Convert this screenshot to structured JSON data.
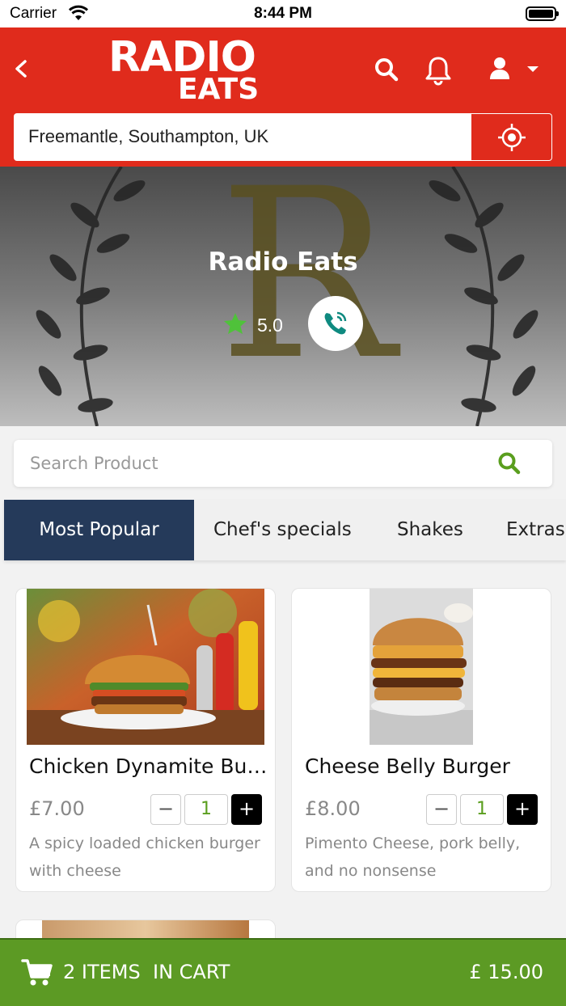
{
  "status_bar": {
    "carrier": "Carrier",
    "time": "8:44 PM"
  },
  "header": {
    "logo_top": "RADIO",
    "logo_bottom": "EATS",
    "location": "Freemantle, Southampton, UK",
    "icons": [
      "back-icon",
      "search-icon",
      "bell-icon",
      "user-icon",
      "chevron-down-icon",
      "locate-icon"
    ]
  },
  "hero": {
    "restaurant_name": "Radio Eats",
    "rating": "5.0",
    "logo_letter": "R"
  },
  "search": {
    "placeholder": "Search Product"
  },
  "tabs": [
    {
      "label": "Most Popular",
      "active": true
    },
    {
      "label": "Chef's specials",
      "active": false
    },
    {
      "label": "Shakes",
      "active": false
    },
    {
      "label": "Extras",
      "active": false
    }
  ],
  "products": [
    {
      "name": "Chicken Dynamite Burger",
      "price": "£7.00",
      "quantity": "1",
      "description": "A spicy loaded chicken burger with cheese"
    },
    {
      "name": "Cheese Belly Burger",
      "price": "£8.00",
      "quantity": "1",
      "description": "Pimento Cheese, pork belly, and no nonsense"
    }
  ],
  "quantity_controls": {
    "minus": "−",
    "plus": "+"
  },
  "cart": {
    "summary": "2 ITEMS  IN CART",
    "total": "£ 15.00"
  },
  "colors": {
    "brand_red": "#e02b1c",
    "active_tab": "#253a5a",
    "cart_green": "#5c9a24",
    "accent_green": "#5a9e1e",
    "call_teal": "#0f8a80"
  }
}
